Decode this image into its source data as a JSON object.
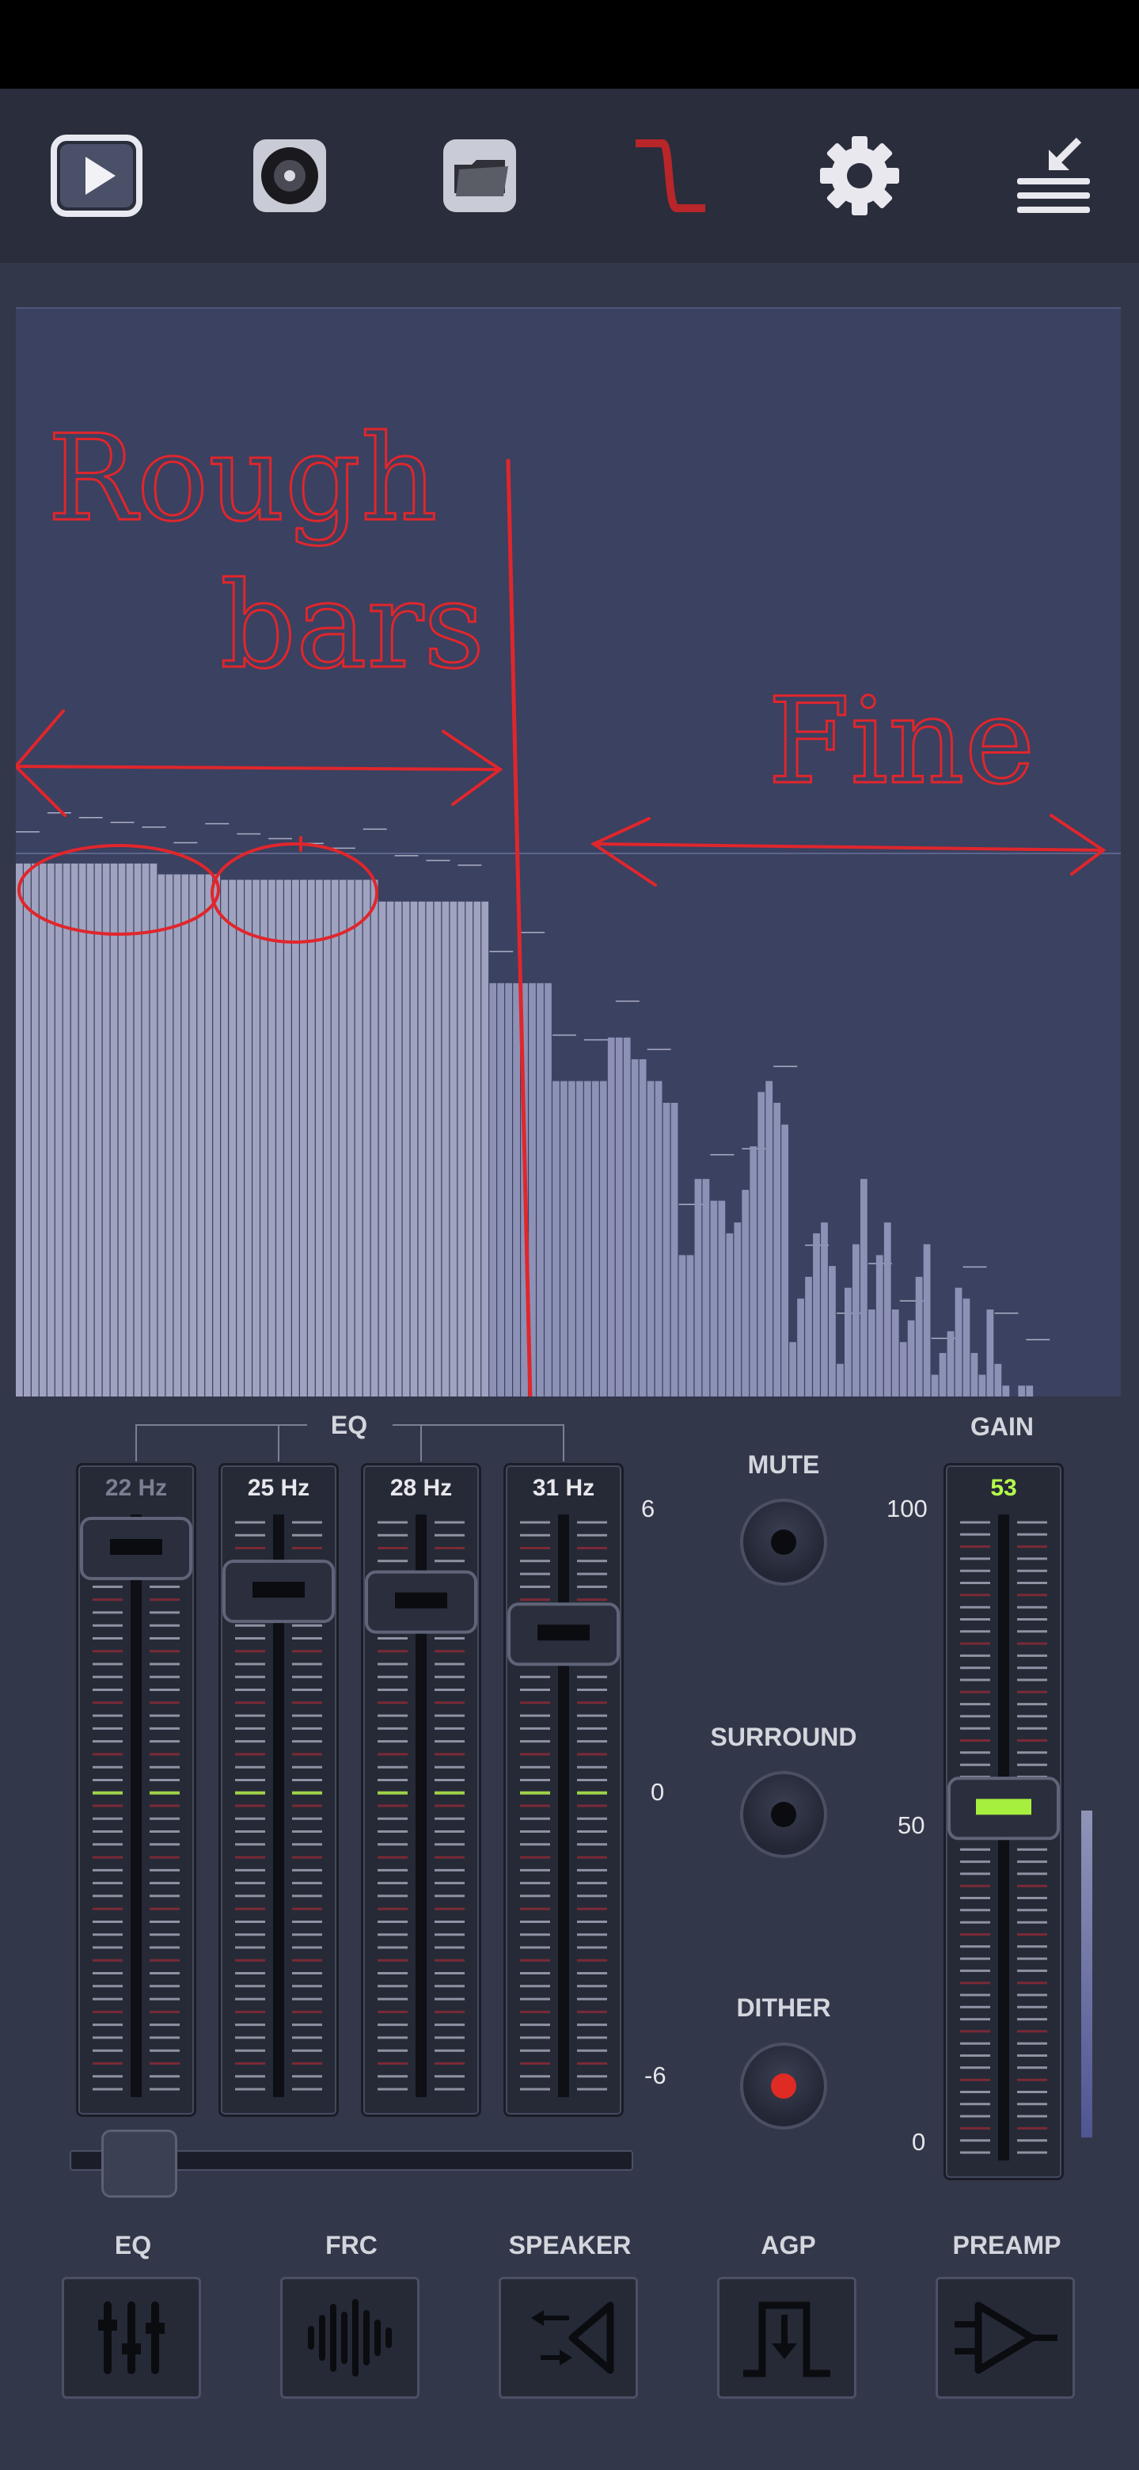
{
  "toolbar": {
    "icons": [
      "play-icon",
      "disc-icon",
      "folder-icon",
      "curve-icon",
      "gear-icon",
      "collapse-menu-icon"
    ]
  },
  "spectrum": {
    "bars": [
      0.49,
      0.49,
      0.49,
      0.49,
      0.49,
      0.49,
      0.49,
      0.49,
      0.49,
      0.49,
      0.49,
      0.49,
      0.49,
      0.49,
      0.49,
      0.49,
      0.49,
      0.49,
      0.48,
      0.48,
      0.48,
      0.48,
      0.48,
      0.48,
      0.48,
      0.48,
      0.475,
      0.475,
      0.475,
      0.475,
      0.475,
      0.475,
      0.475,
      0.475,
      0.475,
      0.475,
      0.475,
      0.475,
      0.475,
      0.475,
      0.475,
      0.475,
      0.475,
      0.475,
      0.475,
      0.475,
      0.455,
      0.455,
      0.455,
      0.455,
      0.455,
      0.455,
      0.455,
      0.455,
      0.455,
      0.455,
      0.455,
      0.455,
      0.455,
      0.455,
      0.38,
      0.38,
      0.38,
      0.38,
      0.38,
      0.38,
      0.38,
      0.38,
      0.29,
      0.29,
      0.29,
      0.29,
      0.29,
      0.29,
      0.29,
      0.33,
      0.33,
      0.33,
      0.31,
      0.31,
      0.29,
      0.29,
      0.27,
      0.27,
      0.13,
      0.13,
      0.2,
      0.2,
      0.18,
      0.18,
      0.15,
      0.16,
      0.19,
      0.23,
      0.28,
      0.29,
      0.27,
      0.25,
      0.05,
      0.09,
      0.11,
      0.15,
      0.16,
      0.12,
      0.03,
      0.1,
      0.14,
      0.2,
      0.08,
      0.13,
      0.16,
      0.08,
      0.05,
      0.07,
      0.11,
      0.14,
      0.02,
      0.04,
      0.06,
      0.1,
      0.09,
      0.04,
      0.02,
      0.08,
      0.03,
      0.01,
      0.0,
      0.01,
      0.01,
      0.0,
      0.0,
      0.0,
      0.0,
      0.0,
      0.0,
      0.0,
      0.0,
      0.0,
      0.0,
      0.0
    ],
    "annotation_rough": "Rough",
    "annotation_bars": "bars",
    "annotation_fine": "Fine"
  },
  "eq": {
    "group_label": "EQ",
    "bands": [
      {
        "label": "22 Hz",
        "level": 0.96
      },
      {
        "label": "25 Hz",
        "level": 0.88
      },
      {
        "label": "28 Hz",
        "level": 0.86
      },
      {
        "label": "31 Hz",
        "level": 0.8
      }
    ],
    "scale_top": "6",
    "scale_mid": "0",
    "scale_bottom": "-6",
    "scroll_position": 0
  },
  "toggles": {
    "mute_label": "MUTE",
    "surround_label": "SURROUND",
    "dither_label": "DITHER",
    "dither_color": "#e02a24"
  },
  "gain": {
    "label": "GAIN",
    "value": "53",
    "level": 0.53,
    "scale_top": "100",
    "scale_mid": "50",
    "scale_bottom": "0",
    "value_color": "#b6ff4a"
  },
  "bottom_nav": [
    {
      "label": "EQ",
      "icon": "sliders-icon"
    },
    {
      "label": "FRC",
      "icon": "waveform-icon"
    },
    {
      "label": "SPEAKER",
      "icon": "speaker-routing-icon"
    },
    {
      "label": "AGP",
      "icon": "agp-icon"
    },
    {
      "label": "PREAMP",
      "icon": "amplifier-icon"
    }
  ]
}
